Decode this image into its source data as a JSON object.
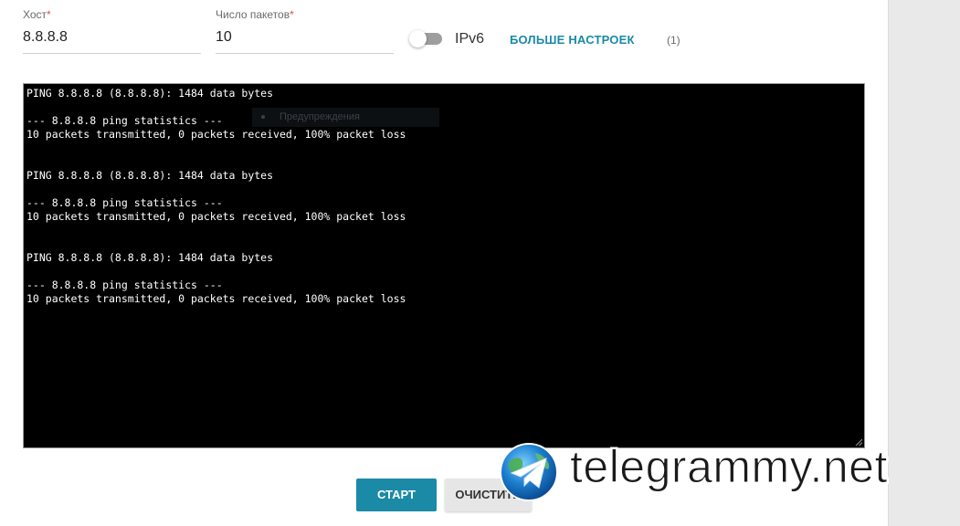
{
  "form": {
    "host": {
      "label": "Хост",
      "required_mark": "*",
      "value": "8.8.8.8"
    },
    "packet_count": {
      "label": "Число пакетов",
      "required_mark": "*",
      "value": "10"
    },
    "ipv6": {
      "label": "IPv6",
      "enabled": false
    },
    "more_settings": {
      "label": "БОЛЬШЕ НАСТРОЕК",
      "count": "(1)"
    }
  },
  "terminal": {
    "lines": [
      "PING 8.8.8.8 (8.8.8.8): 1484 data bytes",
      "",
      "--- 8.8.8.8 ping statistics ---",
      "10 packets transmitted, 0 packets received, 100% packet loss",
      "",
      "",
      "PING 8.8.8.8 (8.8.8.8): 1484 data bytes",
      "",
      "--- 8.8.8.8 ping statistics ---",
      "10 packets transmitted, 0 packets received, 100% packet loss",
      "",
      "",
      "PING 8.8.8.8 (8.8.8.8): 1484 data bytes",
      "",
      "--- 8.8.8.8 ping statistics ---",
      "10 packets transmitted, 0 packets received, 100% packet loss"
    ],
    "ghost_tooltip": "Предупреждения"
  },
  "actions": {
    "start_label": "СТАРТ",
    "clear_label": "ОЧИСТИТЬ"
  },
  "watermark": {
    "text": "telegrammy.net"
  },
  "colors": {
    "accent": "#1b8aa6",
    "terminal_bg": "#000000",
    "terminal_fg": "#ffffff",
    "required": "#d9534f"
  }
}
